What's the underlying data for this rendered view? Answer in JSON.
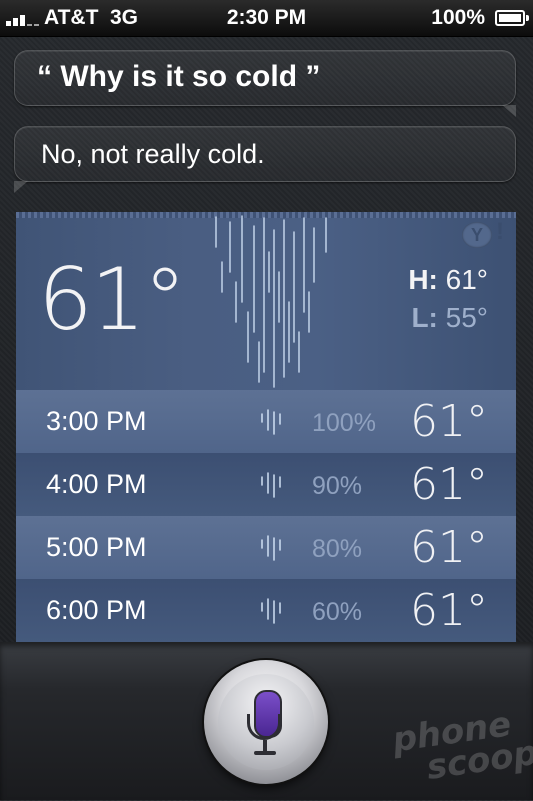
{
  "status_bar": {
    "carrier": "AT&T",
    "network": "3G",
    "time": "2:30 PM",
    "battery": "100%"
  },
  "conversation": {
    "user_query": "Why is it so cold",
    "open_quote": "“",
    "close_quote": "”",
    "siri_response": "No, not really cold."
  },
  "weather": {
    "current_temp": "61",
    "degree": "°",
    "high_label": "H:",
    "high": "61°",
    "low_label": "L:",
    "low": "55°",
    "provider_icon": "yahoo-icon",
    "hourly": [
      {
        "time": "3:00 PM",
        "precip": "100%",
        "temp": "61°"
      },
      {
        "time": "4:00 PM",
        "precip": "90%",
        "temp": "61°"
      },
      {
        "time": "5:00 PM",
        "precip": "80%",
        "temp": "61°"
      },
      {
        "time": "6:00 PM",
        "precip": "60%",
        "temp": "61°"
      }
    ]
  },
  "mic": {
    "icon": "microphone-icon",
    "accent": "#5b35ad"
  },
  "watermark": {
    "line1": "phone",
    "line2": "scoop"
  }
}
